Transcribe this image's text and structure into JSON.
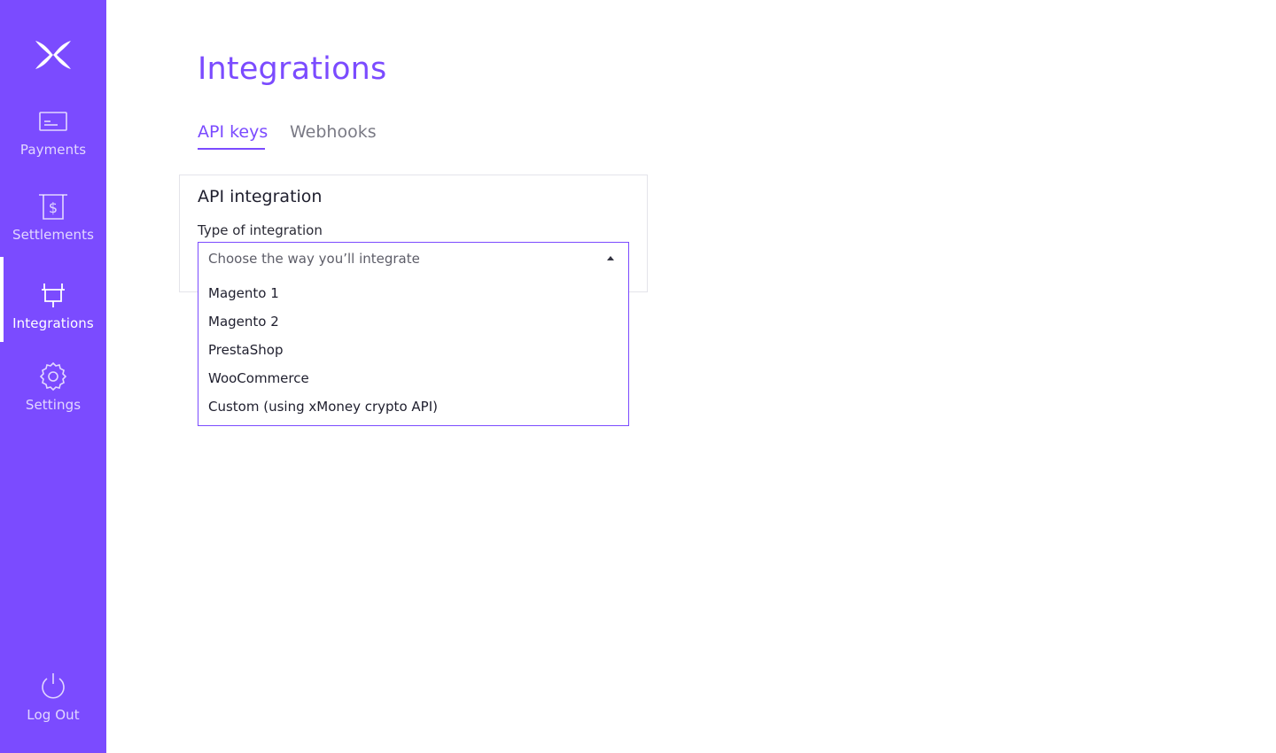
{
  "sidebar": {
    "logo_icon": "x-logo-icon",
    "items": [
      {
        "label": "Payments",
        "icon": "card-icon",
        "active": false
      },
      {
        "label": "Settlements",
        "icon": "dollar-receipt-icon",
        "active": false
      },
      {
        "label": "Integrations",
        "icon": "plug-icon",
        "active": true
      },
      {
        "label": "Settings",
        "icon": "gear-icon",
        "active": false
      }
    ],
    "logout": {
      "label": "Log Out",
      "icon": "power-icon"
    }
  },
  "main": {
    "title": "Integrations",
    "tabs": [
      {
        "label": "API keys",
        "active": true
      },
      {
        "label": "Webhooks",
        "active": false
      }
    ],
    "card": {
      "title": "API integration",
      "field_label": "Type of integration",
      "select": {
        "placeholder": "Choose the way you’ll integrate",
        "open": true,
        "options": [
          "Magento 1",
          "Magento 2",
          "PrestaShop",
          "WooCommerce",
          "Custom (using xMoney crypto API)"
        ]
      }
    }
  },
  "colors": {
    "accent": "#7b4bff",
    "sidebar_bg": "#7b4bff",
    "inactive_tab": "#7a7a85",
    "card_border": "#e4e4ea"
  }
}
